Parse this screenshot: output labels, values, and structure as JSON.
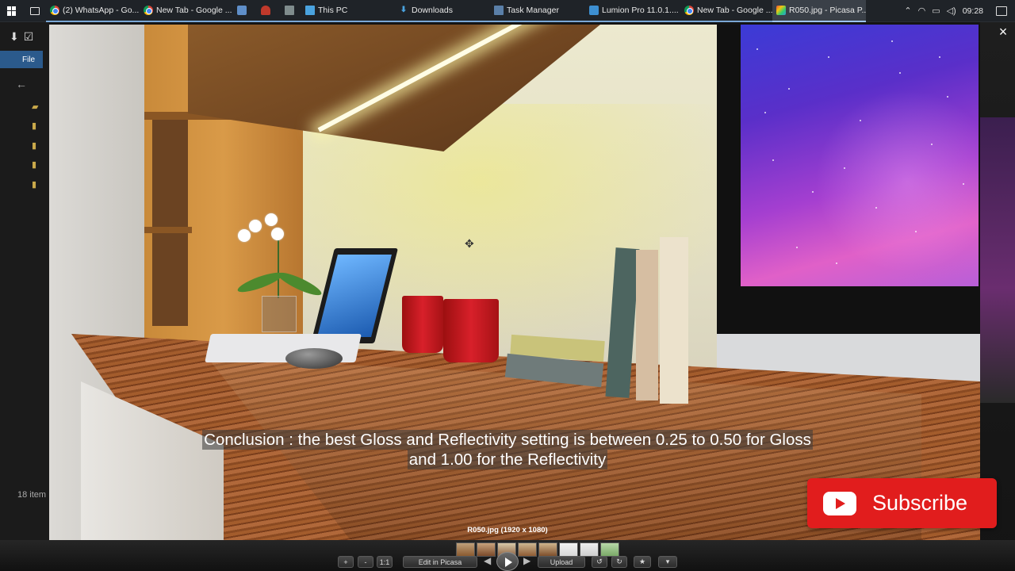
{
  "taskbar": {
    "items": [
      {
        "label": "",
        "icon": "app-icon"
      },
      {
        "label": "(2) WhatsApp - Go...",
        "icon": "chrome-icon"
      },
      {
        "label": "New Tab - Google ...",
        "icon": "chrome-icon"
      },
      {
        "label": "",
        "icon": "app-icon"
      },
      {
        "label": "",
        "icon": "app-icon"
      },
      {
        "label": "",
        "icon": "calculator-icon"
      },
      {
        "label": "This PC",
        "icon": "this-pc-icon"
      },
      {
        "label": "Downloads",
        "icon": "downloads-icon"
      },
      {
        "label": "Task Manager",
        "icon": "task-manager-icon"
      },
      {
        "label": "Lumion Pro 11.0.1....",
        "icon": "lumion-icon"
      },
      {
        "label": "New Tab - Google ...",
        "icon": "chrome-icon"
      },
      {
        "label": "R050.jpg - Picasa P...",
        "icon": "picasa-icon"
      }
    ],
    "clock": "09:28"
  },
  "explorer": {
    "file_tab": "File",
    "item_count": "18 item"
  },
  "viewer": {
    "close_glyph": "×",
    "caption_line1": "Conclusion : the best Gloss and Reflectivity setting is between 0.25 to 0.50 for Gloss",
    "caption_line2": "and 1.00 for the Reflectivity",
    "file_info": "R050.jpg (1920 x 1080)"
  },
  "subscribe": {
    "label": "Subscribe",
    "color": "#e11d1d"
  },
  "picasa_bar": {
    "zoom_in": "+",
    "zoom_out": "-",
    "actual_size": "1:1",
    "edit_label": "Edit in Picasa",
    "upload_label": "Upload",
    "rotate_left": "↺",
    "rotate_right": "↻",
    "star": "★",
    "more": "▾"
  }
}
